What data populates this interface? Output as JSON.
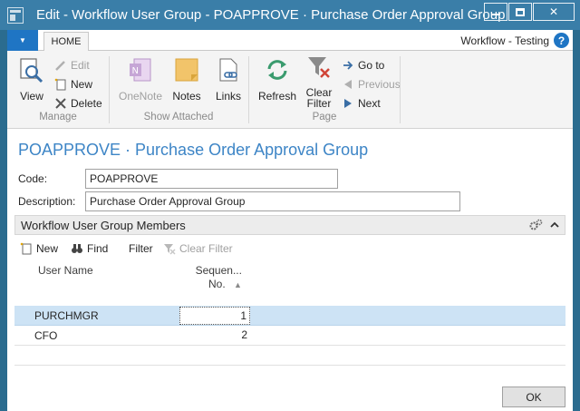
{
  "window": {
    "title": "Edit - Workflow User Group - POAPPROVE · Purchase Order Approval Group",
    "min_label": "",
    "close_label": "✕"
  },
  "tabs": {
    "home": "HOME",
    "company": "Workflow - Testing",
    "help": "?"
  },
  "ribbon": {
    "manage": {
      "label": "Manage",
      "view": "View",
      "edit": "Edit",
      "new": "New",
      "delete": "Delete"
    },
    "show_attached": {
      "label": "Show Attached",
      "onenote": "OneNote",
      "notes": "Notes",
      "links": "Links"
    },
    "page": {
      "label": "Page",
      "refresh": "Refresh",
      "clear_filter_1": "Clear",
      "clear_filter_2": "Filter",
      "go_to": "Go to",
      "previous": "Previous",
      "next": "Next"
    }
  },
  "card": {
    "title": "POAPPROVE · Purchase Order Approval Group",
    "code_label": "Code:",
    "code_value": "POAPPROVE",
    "description_label": "Description:",
    "description_value": "Purchase Order Approval Group"
  },
  "members": {
    "title": "Workflow User Group Members",
    "toolbar": {
      "new": "New",
      "find": "Find",
      "filter": "Filter",
      "clear_filter": "Clear Filter"
    },
    "columns": {
      "user_name": "User Name",
      "sequence_1": "Sequen...",
      "sequence_2": "No."
    },
    "rows": [
      {
        "user": "PURCHMGR",
        "seq": "1"
      },
      {
        "user": "CFO",
        "seq": "2"
      }
    ]
  },
  "buttons": {
    "ok": "OK"
  },
  "colors": {
    "titlebar": "#3a7ea8",
    "accent": "#1f75c4",
    "title_text": "#3d85c6",
    "selected_row": "#cde3f5",
    "refresh_green": "#3a9b6e",
    "delete_red": "#d04437"
  }
}
